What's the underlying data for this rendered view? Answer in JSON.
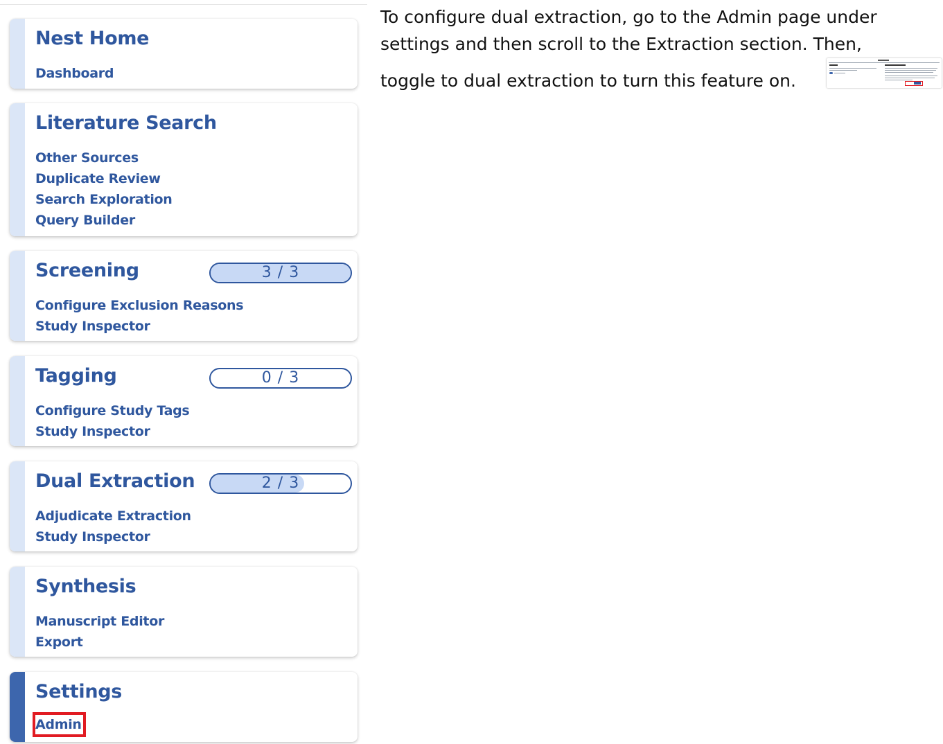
{
  "sidebar": {
    "cards": [
      {
        "title": "Nest Home",
        "links": [
          "Dashboard"
        ]
      },
      {
        "title": "Literature Search",
        "links": [
          "Other Sources",
          "Duplicate Review",
          "Search Exploration",
          "Query Builder"
        ]
      },
      {
        "title": "Screening",
        "progress": {
          "text": "3 / 3",
          "done": 3,
          "total": 3
        },
        "links": [
          "Configure Exclusion Reasons",
          "Study Inspector"
        ]
      },
      {
        "title": "Tagging",
        "progress": {
          "text": "0 / 3",
          "done": 0,
          "total": 3
        },
        "links": [
          "Configure Study Tags",
          "Study Inspector"
        ]
      },
      {
        "title": "Dual Extraction",
        "progress": {
          "text": "2 / 3",
          "done": 2,
          "total": 3
        },
        "links": [
          "Adjudicate Extraction",
          "Study Inspector"
        ]
      },
      {
        "title": "Synthesis",
        "links": [
          "Manuscript Editor",
          "Export"
        ]
      },
      {
        "title": "Settings",
        "links": [
          "Admin"
        ],
        "active": true,
        "highlighted_link": "Admin"
      }
    ]
  },
  "instruction": {
    "line1": "To configure dual extraction, go to the Admin page under",
    "line2": "settings and then scroll to the Extraction section. Then,",
    "line3": "toggle to dual extraction to turn this feature on."
  },
  "colors": {
    "brand_blue": "#2f579e",
    "accent_inactive": "#dbe6f7",
    "accent_active": "#3d66ad",
    "progress_fill": "#c8d9f5",
    "highlight_red": "#e11b22"
  }
}
